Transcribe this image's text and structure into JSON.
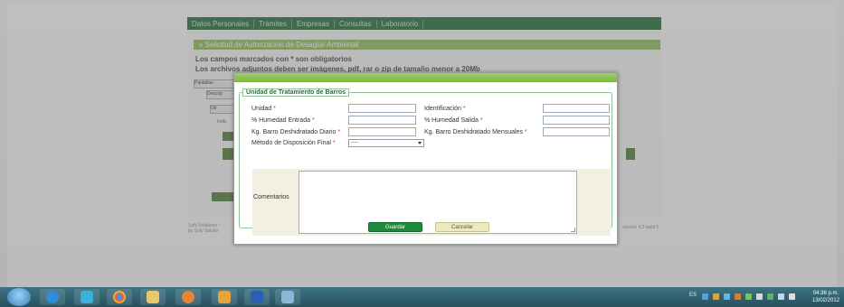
{
  "nav": [
    "Datos Personales",
    "Trámites",
    "Empresas",
    "Consultas",
    "Laboratorio"
  ],
  "page": {
    "section_title": "» Solicitud de Autorización de Desagüe Ambiental",
    "required_note": "Los campos marcados con * son obligatorios",
    "attachments_note": "Los archivos adjuntos deben ser imágenes, pdf, rar o zip de tamaño menor a 20Mb",
    "partial_labels": [
      "Pantallas",
      "Descrip",
      "Ub",
      "Indic"
    ],
    "footer_left": [
      "Sofy Solutions -",
      "by Sofy Solutio"
    ],
    "footer_right": "versión 4.2 build 5"
  },
  "modal": {
    "legend": "Unidad de Tratamiento de Barros",
    "fields": {
      "unidad": {
        "label": "Unidad",
        "required": "*",
        "value": ""
      },
      "identificacion": {
        "label": "Identificación",
        "required": "*",
        "value": ""
      },
      "humedad_entrada": {
        "label": "% Humedad Entrada",
        "required": "*",
        "value": ""
      },
      "humedad_salida": {
        "label": "% Humedad Salida",
        "required": "*",
        "value": ""
      },
      "kg_diario": {
        "label": "Kg. Barro Deshidratado Diario",
        "required": "*",
        "value": ""
      },
      "kg_mensuales": {
        "label": "Kg. Barro Deshidratado Mensuales",
        "required": "*",
        "value": ""
      },
      "metodo": {
        "label": "Método de Disposición Final",
        "required": "*",
        "selected": "-----"
      },
      "comentarios": {
        "label": "Comentarios",
        "value": ""
      }
    },
    "buttons": {
      "save": "Guardar",
      "cancel": "Cancelar"
    }
  },
  "taskbar": {
    "apps": [
      "start-orb",
      "internet-explorer",
      "media-center",
      "chrome",
      "file-explorer",
      "media-player",
      "outlook",
      "word",
      "folder"
    ],
    "language": "ES",
    "time": "04:36 p.m.",
    "date": "13/02/2012"
  }
}
